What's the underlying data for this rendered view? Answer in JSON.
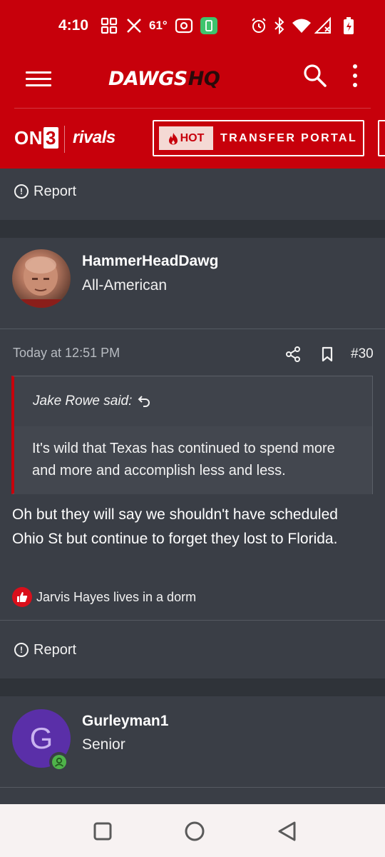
{
  "status_bar": {
    "time": "4:10",
    "temperature": "61°",
    "icons": [
      "grid-icon",
      "x-icon",
      "record-icon",
      "battery-saver-icon",
      "alarm-icon",
      "bluetooth-icon",
      "wifi-icon",
      "signal-icon",
      "battery-icon"
    ]
  },
  "header": {
    "logo_main": "DAWGS",
    "logo_accent": "HQ",
    "brand_left": "ON",
    "brand_left_num": "3",
    "brand_right": "rivals",
    "portal_badge": "HOT",
    "portal_label": "TRANSFER PORTAL",
    "color": "#c7000b"
  },
  "prev_post": {
    "report_label": "Report"
  },
  "post": {
    "author": "HammerHeadDawg",
    "author_title": "All-American",
    "timestamp": "Today at 12:51 PM",
    "post_number": "#30",
    "quote": {
      "author_line": "Jake Rowe said:",
      "text": "It's wild that Texas has continued to spend more and more and accomplish less and less."
    },
    "body": "Oh but they will say we shouldn't have scheduled Ohio St but continue to forget they lost to Florida.",
    "reaction_text": "Jarvis Hayes lives in a dorm",
    "report_label": "Report"
  },
  "next_post": {
    "avatar_letter": "G",
    "author": "Gurleyman1",
    "author_title": "Senior",
    "avatar_color": "#5a2fa8"
  }
}
